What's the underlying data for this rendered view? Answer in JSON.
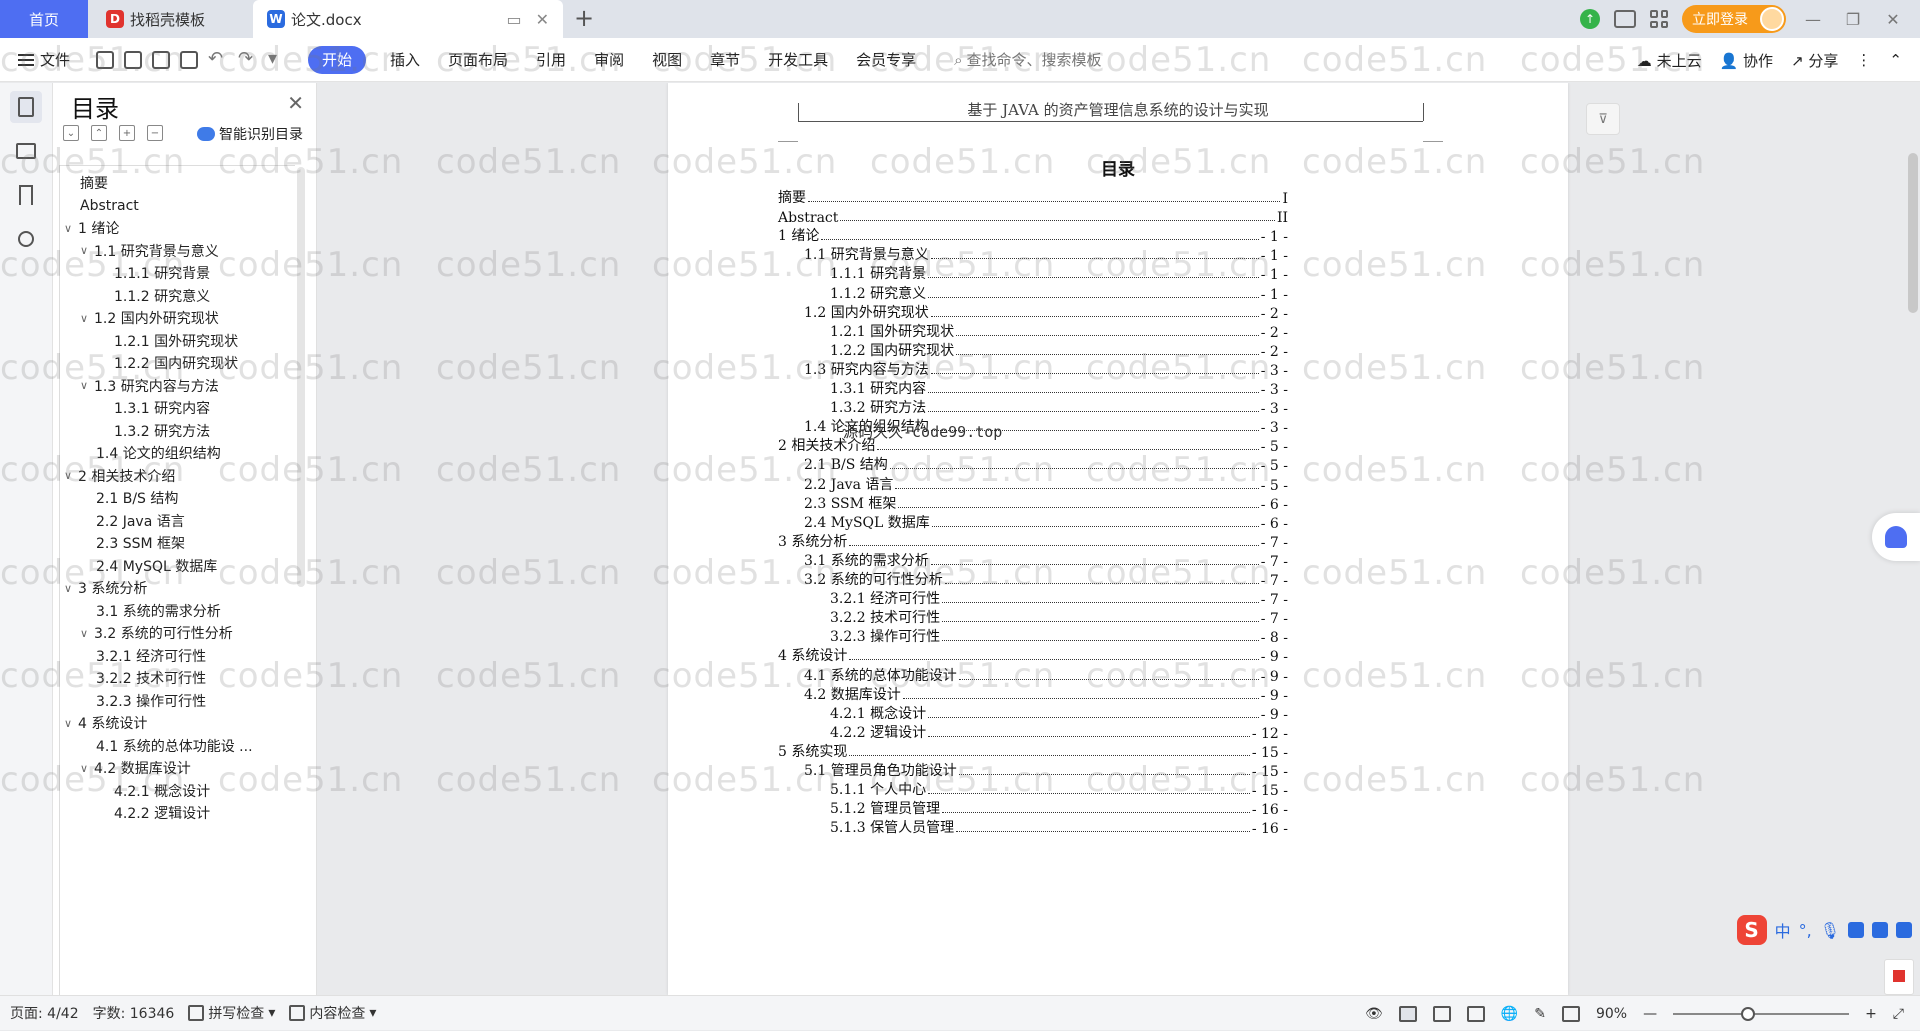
{
  "tabs": {
    "home": "首页",
    "template": "找稻壳模板",
    "document": "论文.docx"
  },
  "titlebar": {
    "login": "立即登录"
  },
  "ribbon": {
    "file": "文件",
    "tabs": [
      "开始",
      "插入",
      "页面布局",
      "引用",
      "审阅",
      "视图",
      "章节",
      "开发工具",
      "会员专享"
    ],
    "search": "查找命令、搜索模板",
    "cloud": "未上云",
    "collab": "协作",
    "share": "分享"
  },
  "toc_panel": {
    "title": "目录",
    "smart": "智能识别目录",
    "items": [
      {
        "text": "摘要",
        "level": 0,
        "chev": false
      },
      {
        "text": "Abstract",
        "level": 0,
        "chev": false
      },
      {
        "text": "1  绪论",
        "level": 0,
        "chev": true
      },
      {
        "text": "1.1  研究背景与意义",
        "level": 1,
        "chev": true
      },
      {
        "text": "1.1.1  研究背景",
        "level": 2,
        "chev": false
      },
      {
        "text": "1.1.2  研究意义",
        "level": 2,
        "chev": false
      },
      {
        "text": "1.2  国内外研究现状",
        "level": 1,
        "chev": true
      },
      {
        "text": "1.2.1  国外研究现状",
        "level": 2,
        "chev": false
      },
      {
        "text": "1.2.2  国内研究现状",
        "level": 2,
        "chev": false
      },
      {
        "text": "1.3  研究内容与方法",
        "level": 1,
        "chev": true
      },
      {
        "text": "1.3.1  研究内容",
        "level": 2,
        "chev": false
      },
      {
        "text": "1.3.2  研究方法",
        "level": 2,
        "chev": false
      },
      {
        "text": "1.4  论文的组织结构",
        "level": 1,
        "chev": false
      },
      {
        "text": "2  相关技术介绍",
        "level": 0,
        "chev": true
      },
      {
        "text": "2.1 B/S 结构",
        "level": 1,
        "chev": false
      },
      {
        "text": "2.2 Java 语言",
        "level": 1,
        "chev": false
      },
      {
        "text": "2.3 SSM 框架",
        "level": 1,
        "chev": false
      },
      {
        "text": "2.4 MySQL 数据库",
        "level": 1,
        "chev": false
      },
      {
        "text": "3  系统分析",
        "level": 0,
        "chev": true
      },
      {
        "text": "3.1  系统的需求分析",
        "level": 1,
        "chev": false
      },
      {
        "text": "3.2  系统的可行性分析",
        "level": 1,
        "chev": true
      },
      {
        "text": "3.2.1  经济可行性",
        "level": 1,
        "chev": false
      },
      {
        "text": "3.2.2  技术可行性",
        "level": 1,
        "chev": false
      },
      {
        "text": "3.2.3  操作可行性",
        "level": 1,
        "chev": false
      },
      {
        "text": "4  系统设计",
        "level": 0,
        "chev": true
      },
      {
        "text": "4.1  系统的总体功能设 ...",
        "level": 1,
        "chev": false
      },
      {
        "text": "4.2  数据库设计",
        "level": 1,
        "chev": true
      },
      {
        "text": "4.2.1  概念设计",
        "level": 2,
        "chev": false
      },
      {
        "text": "4.2.2 逻辑设计",
        "level": 2,
        "chev": false
      }
    ]
  },
  "document": {
    "header": "基于 JAVA 的资产管理信息系统的设计与实现",
    "title": "目录",
    "overlay": "源码久久-code99.top",
    "entries": [
      {
        "label": "摘要",
        "page": "I",
        "indent": 0
      },
      {
        "label": "Abstract",
        "page": "II",
        "indent": 0
      },
      {
        "label": "1  绪论",
        "page": "- 1 -",
        "indent": 0
      },
      {
        "label": "1.1  研究背景与意义",
        "page": "- 1 -",
        "indent": 1
      },
      {
        "label": "1.1.1  研究背景",
        "page": "- 1 -",
        "indent": 2
      },
      {
        "label": "1.1.2  研究意义",
        "page": "- 1 -",
        "indent": 2
      },
      {
        "label": "1.2  国内外研究现状",
        "page": "- 2 -",
        "indent": 1
      },
      {
        "label": "1.2.1  国外研究现状",
        "page": "- 2 -",
        "indent": 2
      },
      {
        "label": "1.2.2  国内研究现状",
        "page": "- 2 -",
        "indent": 2
      },
      {
        "label": "1.3  研究内容与方法",
        "page": "- 3 -",
        "indent": 1
      },
      {
        "label": "1.3.1  研究内容",
        "page": "- 3 -",
        "indent": 2
      },
      {
        "label": "1.3.2  研究方法",
        "page": "- 3 -",
        "indent": 2
      },
      {
        "label": "1.4  论文的组织结构",
        "page": "- 3 -",
        "indent": 1
      },
      {
        "label": "2  相关技术介绍",
        "page": "- 5 -",
        "indent": 0
      },
      {
        "label": "2.1 B/S 结构",
        "page": "- 5 -",
        "indent": 1
      },
      {
        "label": "2.2 Java 语言",
        "page": "- 5 -",
        "indent": 1
      },
      {
        "label": "2.3 SSM 框架",
        "page": "- 6 -",
        "indent": 1
      },
      {
        "label": "2.4 MySQL 数据库",
        "page": "- 6 -",
        "indent": 1
      },
      {
        "label": "3  系统分析",
        "page": "- 7 -",
        "indent": 0
      },
      {
        "label": "3.1  系统的需求分析",
        "page": "- 7 -",
        "indent": 1
      },
      {
        "label": "3.2  系统的可行性分析",
        "page": "- 7 -",
        "indent": 1
      },
      {
        "label": "3.2.1  经济可行性",
        "page": "- 7 -",
        "indent": 2
      },
      {
        "label": "3.2.2  技术可行性",
        "page": "- 7 -",
        "indent": 2
      },
      {
        "label": "3.2.3  操作可行性",
        "page": "- 8 -",
        "indent": 2
      },
      {
        "label": "4  系统设计",
        "page": "- 9 -",
        "indent": 0
      },
      {
        "label": "4.1  系统的总体功能设计",
        "page": "- 9 -",
        "indent": 1
      },
      {
        "label": "4.2  数据库设计",
        "page": "- 9 -",
        "indent": 1
      },
      {
        "label": "4.2.1  概念设计",
        "page": "- 9 -",
        "indent": 2
      },
      {
        "label": "4.2.2 逻辑设计",
        "page": "- 12 -",
        "indent": 2
      },
      {
        "label": "5  系统实现",
        "page": "- 15 -",
        "indent": 0
      },
      {
        "label": "5.1  管理员角色功能设计",
        "page": "- 15 -",
        "indent": 1
      },
      {
        "label": "5.1.1  个人中心",
        "page": "- 15 -",
        "indent": 2
      },
      {
        "label": "5.1.2  管理员管理",
        "page": "- 16 -",
        "indent": 2
      },
      {
        "label": "5.1.3  保管人员管理",
        "page": "- 16 -",
        "indent": 2
      }
    ]
  },
  "watermark": "code51.cn",
  "ime": {
    "lang": "中"
  },
  "status": {
    "page": "页面: 4/42",
    "words": "字数: 16346",
    "spell": "拼写检查",
    "content": "内容检查",
    "zoom": "90%",
    "minus": "—",
    "plus": "+"
  }
}
